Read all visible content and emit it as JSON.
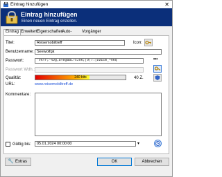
{
  "window": {
    "title": "Eintrag hinzufügen",
    "close": "✕"
  },
  "banner": {
    "title": "Eintrag hinzufügen",
    "subtitle": "Einen neuen Eintrag erstellen."
  },
  "tabs": [
    {
      "label": "Eintrag"
    },
    {
      "label": "Erweitert"
    },
    {
      "label": "Eigenschaften"
    },
    {
      "label": "Auto-Type"
    },
    {
      "label": "Vorgänger"
    }
  ],
  "form": {
    "title_label": "Titel:",
    "title_value": "Reisemobiltreff",
    "icon_label": "Icon:",
    "user_label": "Benutzername:",
    "user_value": "Seewolfgk",
    "password_label": "Passwort:",
    "password_value": "'vkYr;-%Dg,8YegBBC?sJ0k;[9(7:[DzEcm_~hRq",
    "password_repeat_label": "Passwort Wdh.:",
    "password_toggle": "•••",
    "quality_label": "Qualität:",
    "quality_text": "240 bits",
    "quality_fraction": 0.6,
    "length_text": "40 Z.",
    "url_label": "URL:",
    "url_value": "www.reisemobiltreff.de",
    "notes_label": "Kommentare:",
    "expires_label": "Gültig bis:",
    "expires_value": "05.01.2024 00:00:00"
  },
  "buttons": {
    "tools": "Extras",
    "ok": "OK",
    "cancel": "Abbrechen"
  },
  "colors": {
    "banner": "#0b2f7a",
    "link": "#1a4fd8",
    "accent": "#0078d7"
  }
}
